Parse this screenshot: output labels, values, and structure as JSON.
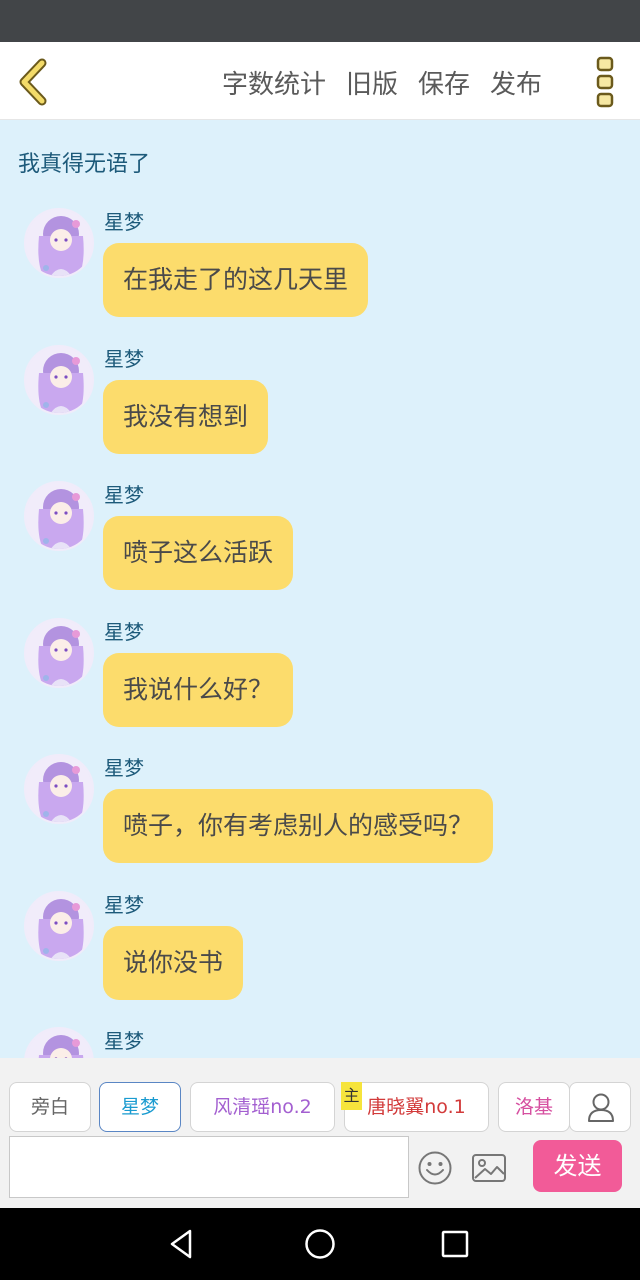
{
  "header": {
    "actions": [
      "字数统计",
      "旧版",
      "保存",
      "发布"
    ]
  },
  "chat": {
    "title": "我真得无语了",
    "messages": [
      {
        "sender": "星梦",
        "text": "在我走了的这几天里"
      },
      {
        "sender": "星梦",
        "text": "我没有想到"
      },
      {
        "sender": "星梦",
        "text": "喷子这么活跃"
      },
      {
        "sender": "星梦",
        "text": "我说什么好？"
      },
      {
        "sender": "星梦",
        "text": "喷子，你有考虑别人的感受吗？"
      },
      {
        "sender": "星梦",
        "text": "说你没书"
      },
      {
        "sender": "星梦",
        "text": ""
      }
    ]
  },
  "roles": [
    {
      "name": "旁白",
      "color": "#666666"
    },
    {
      "name": "星梦",
      "color": "#1a9bd0"
    },
    {
      "name": "风清瑶no.2",
      "color": "#a35fd0"
    },
    {
      "name": "唐晓翼no.1",
      "color": "#d23a3a"
    },
    {
      "name": "洛基",
      "color": "#d64fa0"
    }
  ],
  "main_tag": "主",
  "input": {
    "value": "",
    "placeholder": ""
  },
  "send_label": "发送",
  "colors": {
    "chat_background": "#ddf1fb",
    "bubble": "#fcdc6c",
    "send_button": "#f25b98",
    "accent_icon": "#e6cf5c"
  },
  "icons": {
    "back": "back-chevron-icon",
    "menu": "vertical-dots-icon",
    "emoji": "smiley-icon",
    "image": "image-icon",
    "contact": "person-icon",
    "nav": [
      "back-triangle-icon",
      "home-circle-icon",
      "recents-square-icon"
    ]
  }
}
